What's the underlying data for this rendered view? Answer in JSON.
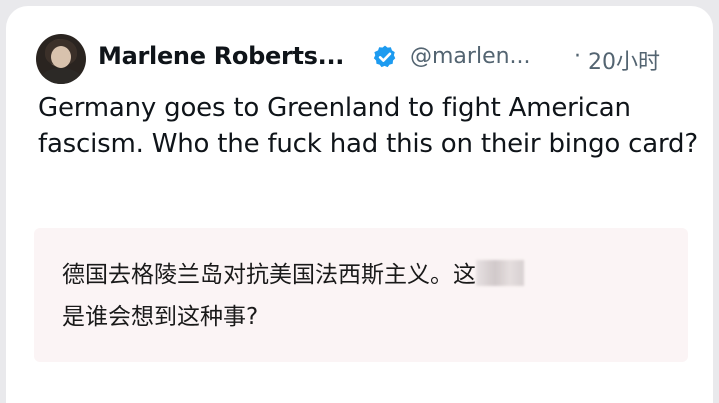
{
  "post": {
    "author_name": "Marlene Roberts...",
    "handle": "@marlen...",
    "separator": "·",
    "time": "20小时",
    "text": "Germany goes to Greenland to fight American fascism.  Who the fuck had this on their bingo card?",
    "icons": {
      "avatar": "profile-photo",
      "verified": "verified-badge-icon"
    },
    "colors": {
      "verified": "#1d9bf0",
      "handle": "#536471",
      "translation_bg": "#fbf4f5"
    }
  },
  "translation": {
    "text_before_blur": "德国去格陵兰岛对抗美国法西斯主义。这",
    "text_after_blur": "是谁会想到这种事?"
  }
}
